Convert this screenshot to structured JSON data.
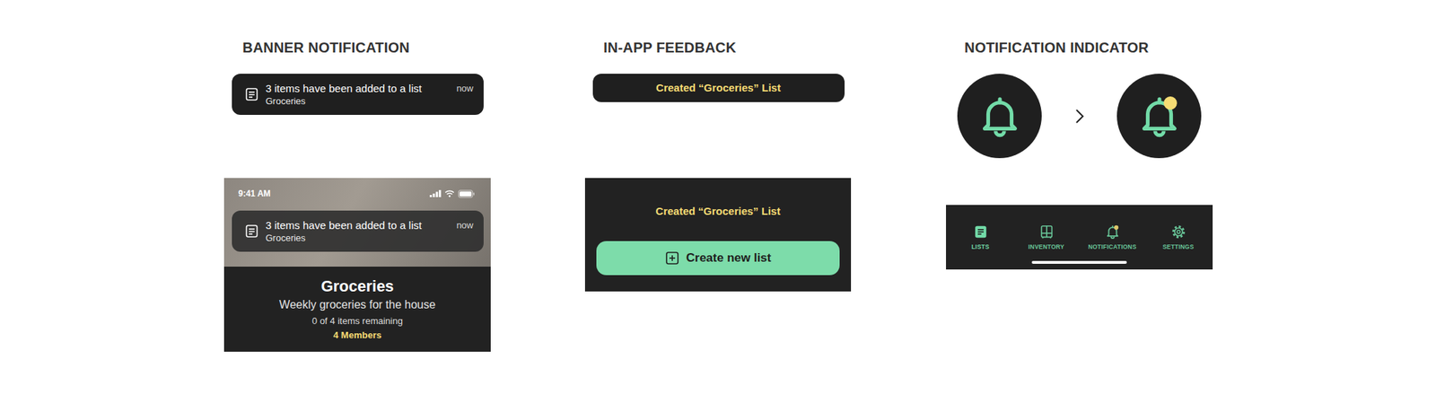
{
  "banner_notification": {
    "heading": "BANNER NOTIFICATION",
    "banner": {
      "title": "3 items have been added to a list",
      "subtitle": "Groceries",
      "time": "now"
    },
    "phone": {
      "status_time": "9:41 AM",
      "banner": {
        "title": "3 items have been added to a list",
        "subtitle": "Groceries",
        "time": "now"
      },
      "list": {
        "title": "Groceries",
        "description": "Weekly groceries for the house",
        "remaining": "0 of 4 items remaining",
        "members": "4 Members"
      }
    }
  },
  "in_app_feedback": {
    "heading": "IN-APP FEEDBACK",
    "toast": "Created “Groceries” List",
    "panel": {
      "toast": "Created “Groceries” List",
      "button": "Create new list"
    }
  },
  "notification_indicator": {
    "heading": "NOTIFICATION INDICATOR",
    "bells": [
      {
        "unread": false
      },
      {
        "unread": true
      }
    ],
    "tab_bar": {
      "tabs": [
        {
          "label": "LISTS",
          "kind": "lists",
          "selected": true,
          "unread": false
        },
        {
          "label": "INVENTORY",
          "kind": "inventory",
          "selected": false,
          "unread": false
        },
        {
          "label": "NOTIFICATIONS",
          "kind": "notifications",
          "selected": false,
          "unread": true
        },
        {
          "label": "SETTINGS",
          "kind": "settings",
          "selected": false,
          "unread": false
        }
      ]
    }
  }
}
